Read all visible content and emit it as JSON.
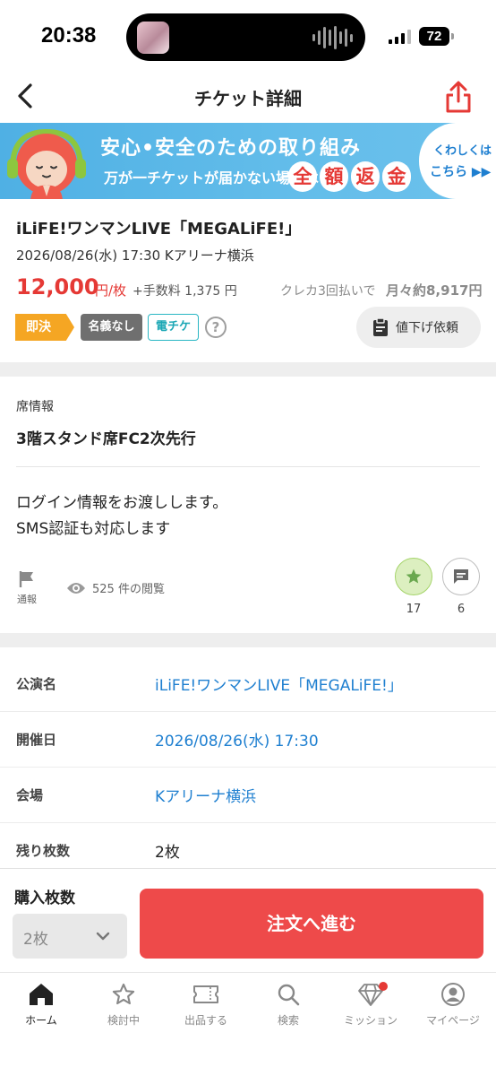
{
  "status_bar": {
    "time": "20:38",
    "battery": "72"
  },
  "header": {
    "title": "チケット詳細",
    "back_icon": "chevron-left-icon",
    "share_icon": "share-icon"
  },
  "banner": {
    "headline": "安心•安全のための取り組み",
    "subtext": "万が一チケットが届かない場合は",
    "refund_chars": [
      "全",
      "額",
      "返",
      "金"
    ],
    "link_top": "くわしくは",
    "link_bottom": "こちら ▶▶"
  },
  "ticket": {
    "title": "iLiFE!ワンマンLIVE「MEGALiFE!」",
    "datetime_venue": "2026/08/26(水) 17:30 Kアリーナ横浜",
    "price": "12,000",
    "price_unit": "円/枚",
    "fee": "+手数料 1,375 円",
    "installment_text": "クレカ3回払いで",
    "installment_amount": "月々約8,917円",
    "tags": {
      "quick": "即決",
      "noname": "名義なし",
      "eticket": "電チケ"
    },
    "help_symbol": "?",
    "price_request_label": "値下げ依頼"
  },
  "seat": {
    "label": "席情報",
    "value": "3階スタンド席FC2次先行",
    "note_line1": "ログイン情報をお渡しします。",
    "note_line2": "SMS認証も対応します"
  },
  "engagement": {
    "report_label": "通報",
    "views": "525 件の閲覧",
    "favorites": "17",
    "comments": "6"
  },
  "details": [
    {
      "key": "公演名",
      "value": "iLiFE!ワンマンLIVE「MEGALiFE!」"
    },
    {
      "key": "開催日",
      "value": "2026/08/26(水) 17:30"
    },
    {
      "key": "会場",
      "value": "Kアリーナ横浜"
    },
    {
      "key": "残り枚数",
      "value": "2枚"
    }
  ],
  "purchase": {
    "qty_label": "購入枚数",
    "qty_value": "2枚",
    "order_button": "注文へ進む"
  },
  "tabs": [
    {
      "label": "ホーム",
      "icon": "home-icon"
    },
    {
      "label": "検討中",
      "icon": "star-icon"
    },
    {
      "label": "出品する",
      "icon": "ticket-icon"
    },
    {
      "label": "検索",
      "icon": "search-icon"
    },
    {
      "label": "ミッション",
      "icon": "diamond-icon"
    },
    {
      "label": "マイページ",
      "icon": "user-icon"
    }
  ],
  "colors": {
    "accent_red": "#e53935",
    "link_blue": "#1e7fd0",
    "order_button": "#ee4a4a",
    "banner_blue": "#4fb0e4"
  }
}
